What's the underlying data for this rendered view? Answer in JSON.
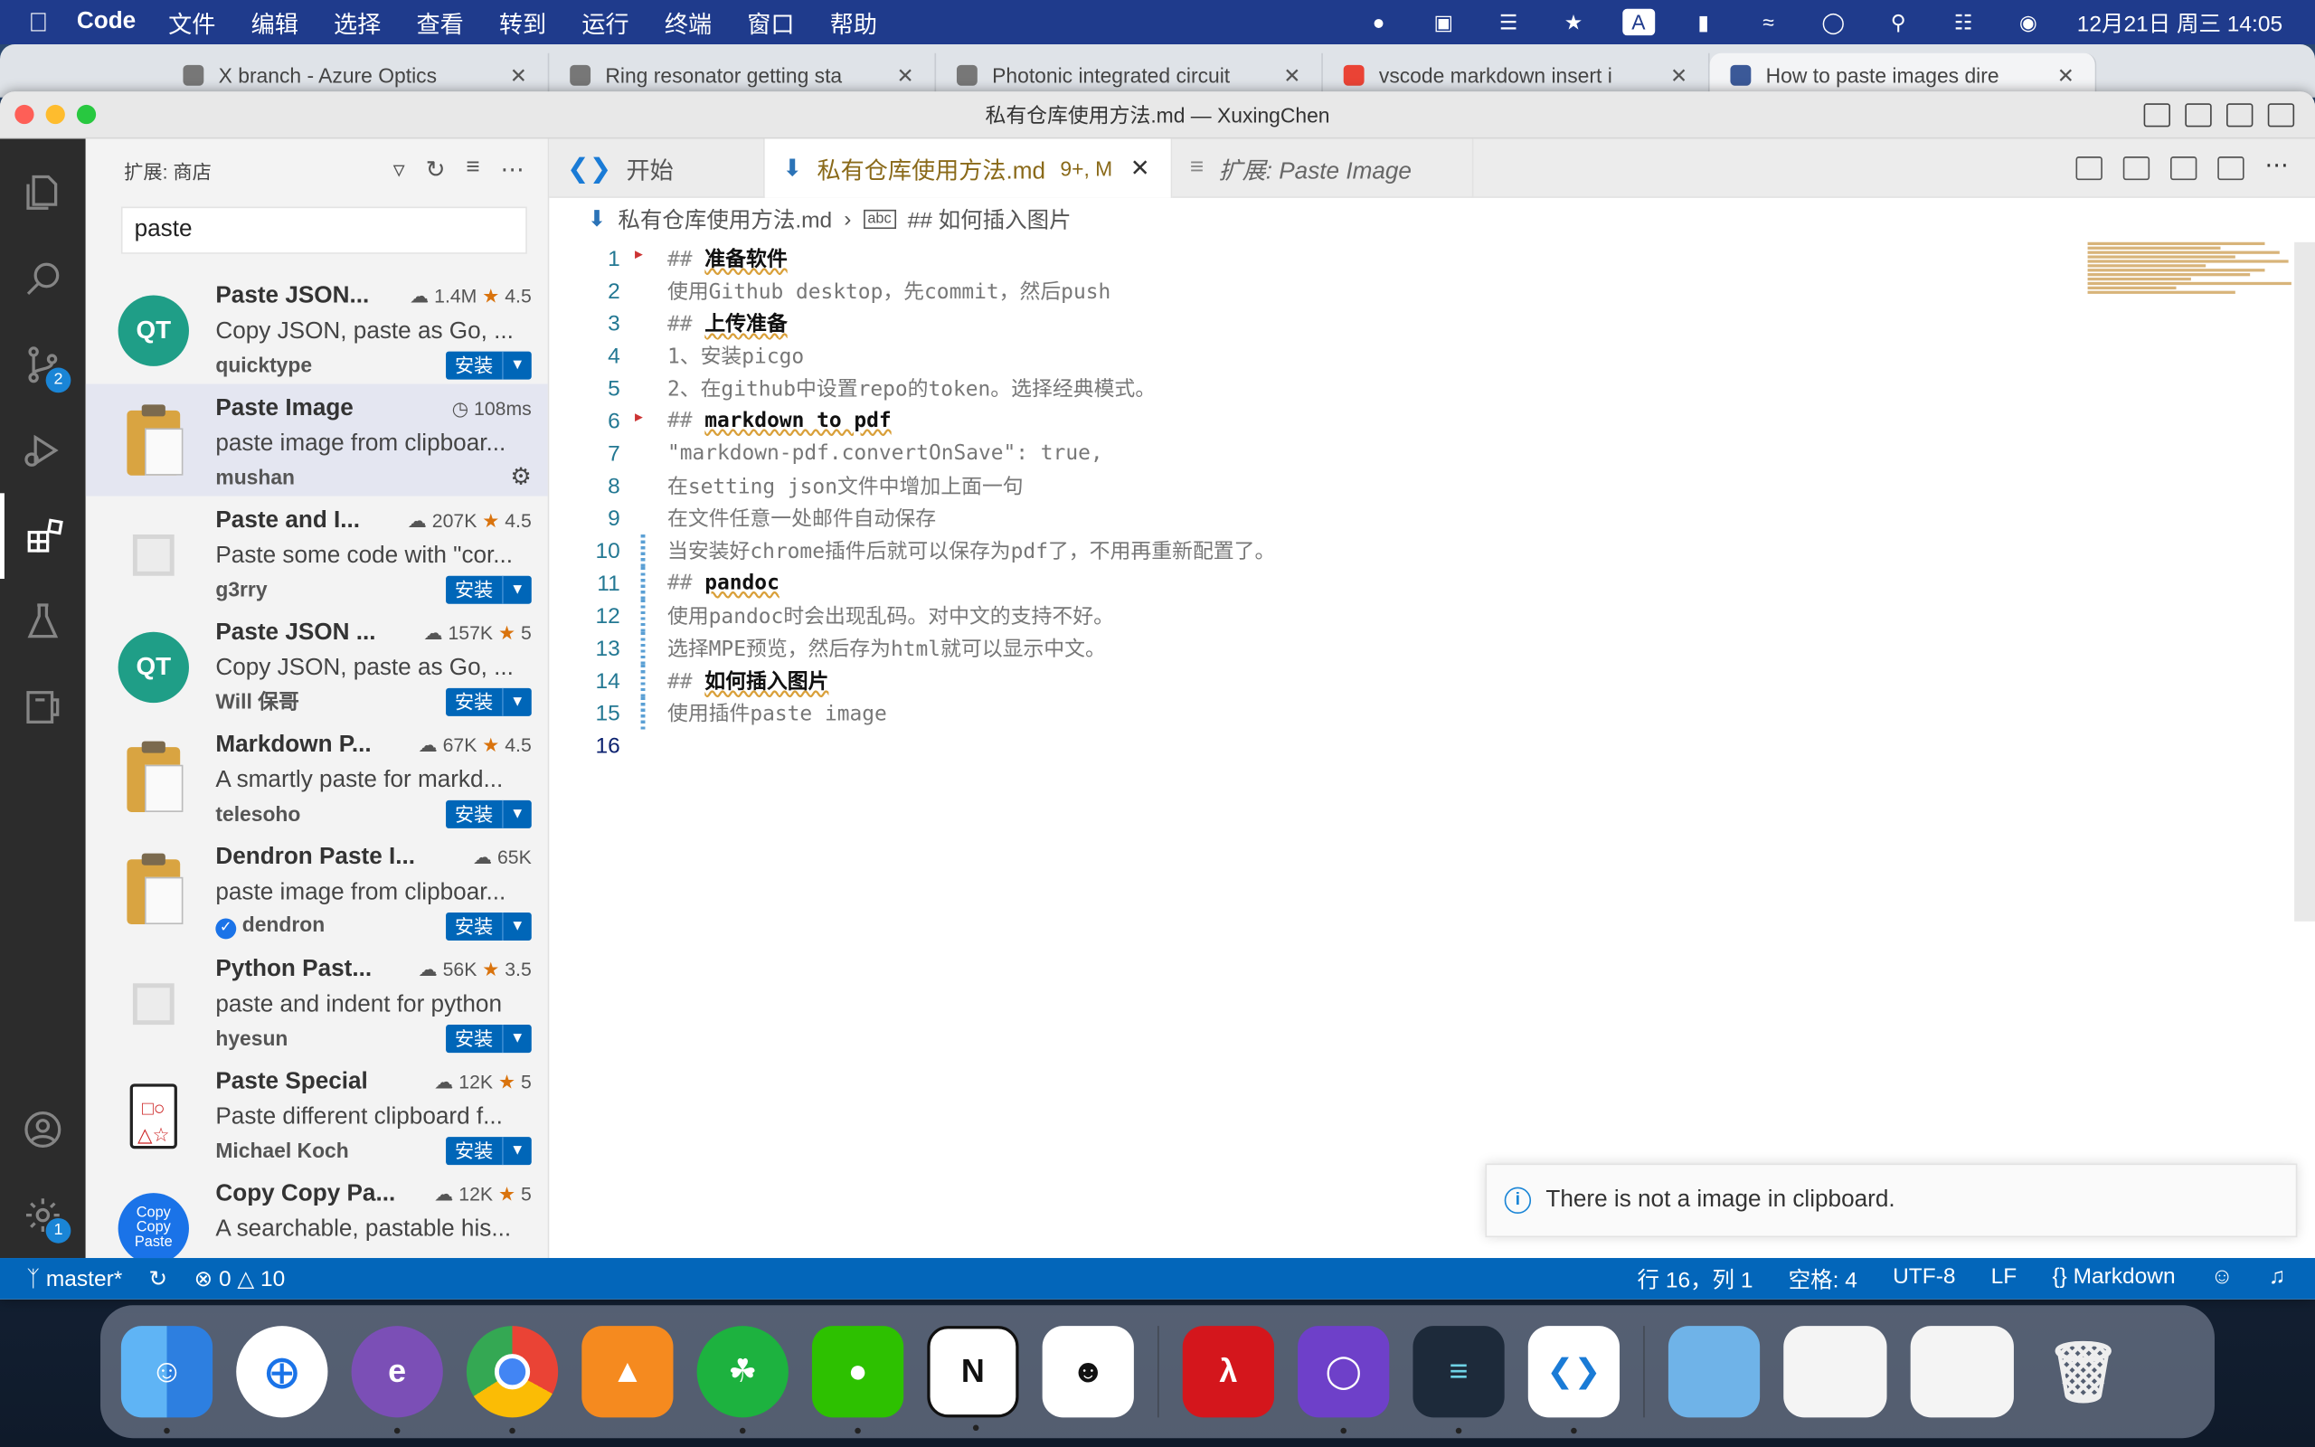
{
  "menubar": {
    "app_name": "Code",
    "menus": [
      "文件",
      "编辑",
      "选择",
      "查看",
      "转到",
      "运行",
      "终端",
      "窗口",
      "帮助"
    ],
    "clock": "12月21日 周三  14:05",
    "input_method": "A"
  },
  "browser_tabs": [
    {
      "label": "X branch - Azure Optics"
    },
    {
      "label": "Ring resonator getting sta"
    },
    {
      "label": "Photonic integrated circuit"
    },
    {
      "label": "vscode markdown insert i"
    },
    {
      "label": "How to paste images dire"
    }
  ],
  "window": {
    "title": "私有仓库使用方法.md — XuxingChen"
  },
  "activity_bar": {
    "source_control_badge": "2",
    "settings_badge": "1"
  },
  "sidebar": {
    "title": "扩展: 商店",
    "search_value": "paste",
    "extensions": [
      {
        "name": "Paste JSON...",
        "stat": "1.4M",
        "rating": "4.5",
        "desc": "Copy JSON, paste as Go, ...",
        "publisher": "quicktype",
        "install": "安装",
        "icon": "qt"
      },
      {
        "name": "Paste Image",
        "stat": "108ms",
        "rating": "",
        "desc": "paste image from clipboar...",
        "publisher": "mushan",
        "install": "",
        "icon": "clip"
      },
      {
        "name": "Paste and I...",
        "stat": "207K",
        "rating": "4.5",
        "desc": "Paste some code with \"cor...",
        "publisher": "g3rry",
        "install": "安装",
        "icon": "gen"
      },
      {
        "name": "Paste JSON ...",
        "stat": "157K",
        "rating": "5",
        "desc": "Copy JSON, paste as Go, ...",
        "publisher": "Will 保哥",
        "install": "安装",
        "icon": "qt"
      },
      {
        "name": "Markdown P...",
        "stat": "67K",
        "rating": "4.5",
        "desc": "A smartly paste for markd...",
        "publisher": "telesoho",
        "install": "安装",
        "icon": "clip"
      },
      {
        "name": "Dendron Paste I...",
        "stat": "65K",
        "rating": "",
        "desc": "paste image from clipboar...",
        "publisher": "dendron",
        "install": "安装",
        "icon": "clip"
      },
      {
        "name": "Python Past...",
        "stat": "56K",
        "rating": "3.5",
        "desc": "paste and indent for python",
        "publisher": "hyesun",
        "install": "安装",
        "icon": "gen"
      },
      {
        "name": "Paste Special",
        "stat": "12K",
        "rating": "5",
        "desc": "Paste different clipboard f...",
        "publisher": "Michael Koch",
        "install": "安装",
        "icon": "board"
      },
      {
        "name": "Copy Copy Pa...",
        "stat": "12K",
        "rating": "5",
        "desc": "A searchable, pastable his...",
        "publisher": "",
        "install": "",
        "icon": "copy"
      }
    ]
  },
  "editor": {
    "tabs": [
      {
        "label": "开始"
      },
      {
        "label": "私有仓库使用方法.md",
        "modified": "9+, M"
      },
      {
        "label": "扩展: Paste Image"
      }
    ],
    "breadcrumb": [
      "私有仓库使用方法.md",
      "## 如何插入图片"
    ],
    "lines": [
      {
        "n": "1",
        "hash": "##",
        "head": "准备软件",
        "text": ""
      },
      {
        "n": "2",
        "hash": "",
        "head": "",
        "text": "使用Github desktop，先commit，然后push"
      },
      {
        "n": "3",
        "hash": "##",
        "head": "上传准备",
        "text": ""
      },
      {
        "n": "4",
        "hash": "",
        "head": "",
        "text": "1、安装picgo"
      },
      {
        "n": "5",
        "hash": "",
        "head": "",
        "text": "2、在github中设置repo的token。选择经典模式。"
      },
      {
        "n": "6",
        "hash": "##",
        "head": "markdown to pdf",
        "text": ""
      },
      {
        "n": "7",
        "hash": "",
        "head": "",
        "text": "\"markdown-pdf.convertOnSave\": true,"
      },
      {
        "n": "8",
        "hash": "",
        "head": "",
        "text": "在setting json文件中增加上面一句"
      },
      {
        "n": "9",
        "hash": "",
        "head": "",
        "text": "在文件任意一处邮件自动保存"
      },
      {
        "n": "10",
        "hash": "",
        "head": "",
        "text": "当安装好chrome插件后就可以保存为pdf了，不用再重新配置了。"
      },
      {
        "n": "11",
        "hash": "##",
        "head": "pandoc",
        "text": ""
      },
      {
        "n": "12",
        "hash": "",
        "head": "",
        "text": "使用pandoc时会出现乱码。对中文的支持不好。"
      },
      {
        "n": "13",
        "hash": "",
        "head": "",
        "text": "选择MPE预览，然后存为html就可以显示中文。"
      },
      {
        "n": "14",
        "hash": "##",
        "head": "如何插入图片",
        "text": ""
      },
      {
        "n": "15",
        "hash": "",
        "head": "",
        "text": "使用插件paste image"
      },
      {
        "n": "16",
        "hash": "",
        "head": "",
        "text": ""
      }
    ]
  },
  "notification": {
    "message": "There is not a image in clipboard."
  },
  "statusbar": {
    "branch": "master*",
    "errors": "0",
    "warnings": "10",
    "position": "行 16，列 1",
    "spaces": "空格: 4",
    "encoding": "UTF-8",
    "eol": "LF",
    "language": "Markdown"
  },
  "dock": {
    "apps": [
      "finder",
      "safari",
      "emacs",
      "chrome",
      "books",
      "evernote",
      "wechat",
      "notion",
      "typora",
      "acrobat",
      "github-desktop",
      "clash",
      "vscode",
      "preview",
      "screenshot",
      "notion-doc",
      "trash"
    ]
  }
}
